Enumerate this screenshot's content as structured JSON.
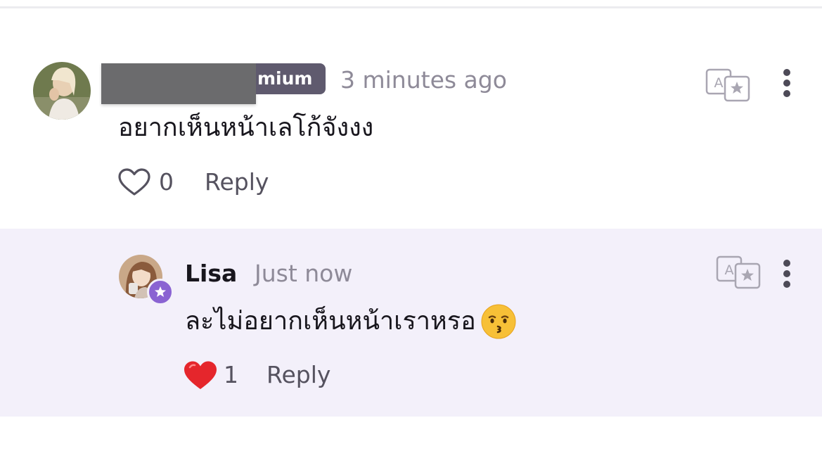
{
  "colors": {
    "reply_background": "#f3f0fa",
    "premium_badge": "#5f5a6e",
    "star_badge": "#8a63d2",
    "heart_filled": "#e5262c",
    "secondary_text": "#8e8a98"
  },
  "comments": [
    {
      "author_visible_fragment": "mium",
      "author_redacted": true,
      "timestamp": "3 minutes ago",
      "text": "อยากเห็นหน้าเลโก้จังงง",
      "likes": "0",
      "liked": false,
      "reply_label": "Reply",
      "icons": [
        "avatar",
        "translate-icon",
        "more-icon",
        "heart-outline-icon"
      ]
    },
    {
      "author": "Lisa",
      "timestamp": "Just now",
      "text": "ละไม่อยากเห็นหน้าเราหรอ",
      "emoji": "kissing-face-emoji",
      "likes": "1",
      "liked": true,
      "reply_label": "Reply",
      "icons": [
        "avatar",
        "star-badge-icon",
        "translate-icon",
        "more-icon",
        "heart-filled-icon"
      ]
    }
  ]
}
